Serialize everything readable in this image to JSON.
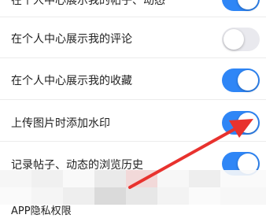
{
  "settings": {
    "rows": [
      {
        "label": "在个人中心展示我的帖子、动态",
        "enabled": true
      },
      {
        "label": "在个人中心展示我的评论",
        "enabled": false
      },
      {
        "label": "在个人中心展示我的收藏",
        "enabled": true
      },
      {
        "label": "上传图片时添加水印",
        "enabled": true
      },
      {
        "label": "记录帖子、动态的浏览历史",
        "enabled": true
      },
      {
        "label": "APP隐私权限"
      }
    ]
  },
  "colors": {
    "toggle_on": "#2f86f6",
    "toggle_off": "#e9e9ee",
    "arrow": "#e8322e"
  }
}
